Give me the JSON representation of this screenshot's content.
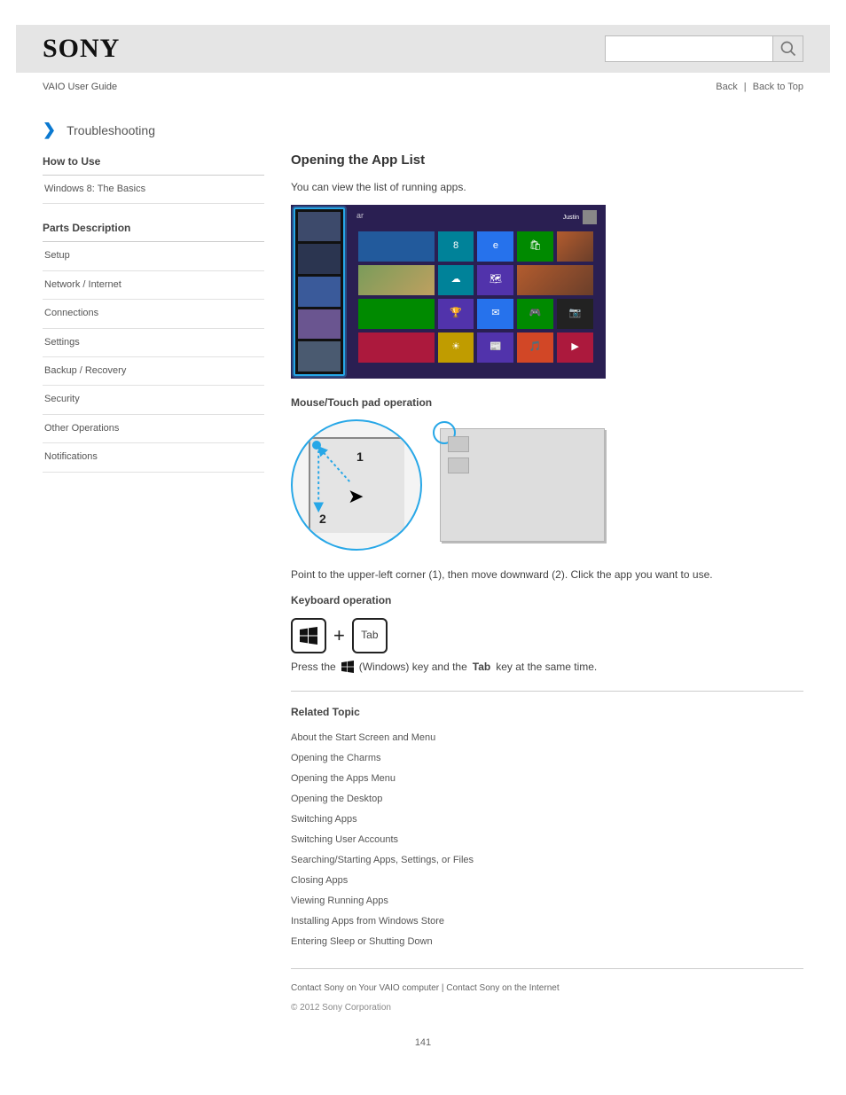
{
  "header": {
    "brand": "SONY",
    "model": "VAIO User Guide",
    "back_link": "Back",
    "top_link": "Back to Top"
  },
  "search": {
    "placeholder": ""
  },
  "crumb": "Troubleshooting",
  "sidebar": {
    "group1_head": "How to Use",
    "group1_items": [
      "Windows 8: The Basics"
    ],
    "group2_head": "Parts Description",
    "group2_items": [
      "Setup",
      "Network / Internet",
      "Connections",
      "Settings",
      "Backup / Recovery",
      "Security",
      "Other Operations",
      "Notifications"
    ]
  },
  "main": {
    "title": "Opening the App List",
    "intro": "You can view the list of running apps.",
    "mouse_heading": "Mouse/Touch pad operation",
    "mouse_text": "Point to the upper-left corner (1), then move downward (2). Click the app you want to use.",
    "kbd_heading": "Keyboard operation",
    "kbd_plus": "+",
    "kbd_tab": "Tab",
    "kbd_hint_prefix": "Press the ",
    "kbd_hint_mid": " (Windows) key and the ",
    "kbd_hint_key": "Tab",
    "kbd_hint_suffix": " key at the same time.",
    "related_head": "Related Topic",
    "related": [
      "About the Start Screen and Menu",
      "Opening the Charms",
      "Opening the Apps Menu",
      "Opening the Desktop",
      "Switching Apps",
      "Switching User Accounts",
      "Searching/Starting Apps, Settings, or Files",
      "Closing Apps",
      "Viewing Running Apps",
      "Installing Apps from Windows Store",
      "Entering Sleep or Shutting Down"
    ],
    "meta": "Contact Sony on Your VAIO computer | Contact Sony on the Internet",
    "copyright": "© 2012 Sony Corporation"
  },
  "start_screen": {
    "label": "ar",
    "user": "Justin"
  },
  "page_number": "141"
}
